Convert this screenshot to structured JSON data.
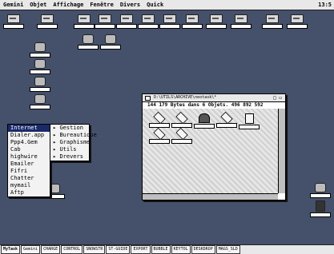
{
  "menubar": {
    "items": [
      "Gemini",
      "Objet",
      "Affichage",
      "Fenêtre",
      "Divers",
      "Quick"
    ],
    "clock": "13:5"
  },
  "desktop_icons": [
    {
      "label": "",
      "glyph": "drive"
    },
    {
      "label": "",
      "glyph": "drive"
    },
    {
      "label": "",
      "glyph": "drive"
    },
    {
      "label": "",
      "glyph": "drive"
    },
    {
      "label": "",
      "glyph": "drive"
    },
    {
      "label": "",
      "glyph": "drive"
    },
    {
      "label": "",
      "glyph": "drive"
    },
    {
      "label": "",
      "glyph": "drive"
    },
    {
      "label": "",
      "glyph": "drive"
    },
    {
      "label": "",
      "glyph": "drive"
    },
    {
      "label": "",
      "glyph": "drive"
    },
    {
      "label": "",
      "glyph": "drive"
    },
    {
      "label": "",
      "glyph": "tool"
    },
    {
      "label": "",
      "glyph": "tool"
    },
    {
      "label": "",
      "glyph": "tool"
    },
    {
      "label": "",
      "glyph": "tool"
    },
    {
      "label": "",
      "glyph": "tool"
    },
    {
      "label": "",
      "glyph": "tool"
    },
    {
      "label": "",
      "glyph": "tool"
    },
    {
      "label": "",
      "glyph": "tool"
    },
    {
      "label": "",
      "glyph": "dark"
    }
  ],
  "popup_menu": {
    "items": [
      "Internet",
      "Dialer.app",
      "Ppp4.Gem",
      "Cab",
      "highwire",
      "Emailer",
      "Fifri",
      "Chatter",
      "mymail",
      "Aftp"
    ],
    "selected_index": 0
  },
  "submenu": {
    "items": [
      "Gestion",
      "Bureautique",
      "Graphisme",
      "Utils",
      "Drevers"
    ]
  },
  "window": {
    "title": "D:\\UTILS\\ARCHIVE\\neotask\\*",
    "controls": "□ ▭",
    "info": "144 179 Bytes dans 6 Objets. 496 892 592",
    "items": [
      {
        "label": "",
        "glyph": "folder"
      },
      {
        "label": "",
        "glyph": "folder"
      },
      {
        "label": "",
        "glyph": "sys"
      },
      {
        "label": "",
        "glyph": "folder"
      },
      {
        "label": "",
        "glyph": "doc"
      },
      {
        "label": "",
        "glyph": "folder"
      },
      {
        "label": "",
        "glyph": "folder"
      }
    ]
  },
  "taskbar": {
    "items": [
      "MyTask",
      "Gemini",
      "CHARGE",
      "CONTROL",
      "SNOWSTR",
      "ST-GUIDE",
      "EXPORT",
      "BUBBLE",
      "KEYTOL",
      "DESKDROP",
      "MAGS_SLD"
    ]
  }
}
